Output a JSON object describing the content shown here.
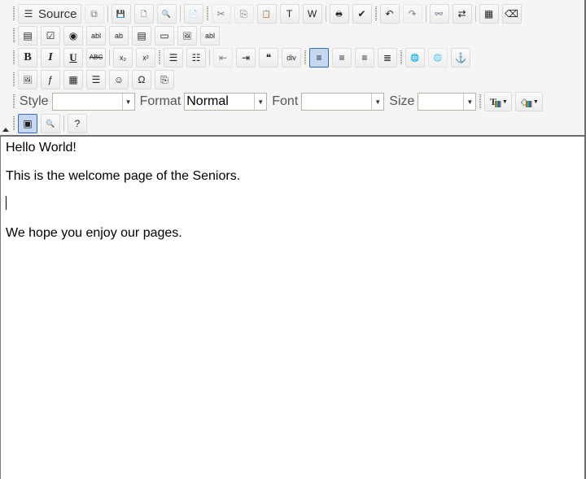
{
  "toolbar": {
    "row1": [
      {
        "name": "source-button",
        "label": "Source",
        "icon": "source-icon",
        "glyph": "☰"
      },
      {
        "name": "templates-button",
        "icon": "templates-icon",
        "glyph": "⧉",
        "disabled": true
      },
      {
        "sep": true
      },
      {
        "name": "save-button",
        "icon": "save-icon",
        "glyph": "💾"
      },
      {
        "name": "new-page-button",
        "icon": "new-page-icon",
        "glyph": "🗋"
      },
      {
        "name": "preview-button",
        "icon": "preview-icon",
        "glyph": "🔍"
      },
      {
        "sep": true
      },
      {
        "name": "document-properties-button",
        "icon": "document-icon",
        "glyph": "📄"
      },
      {
        "grip": true
      },
      {
        "name": "cut-button",
        "icon": "scissors-icon",
        "glyph": "✂",
        "disabled": true
      },
      {
        "name": "copy-button",
        "icon": "copy-icon",
        "glyph": "⎘",
        "disabled": true
      },
      {
        "name": "paste-button",
        "icon": "paste-icon",
        "glyph": "📋"
      },
      {
        "name": "paste-text-button",
        "icon": "paste-text-icon",
        "glyph": "T"
      },
      {
        "name": "paste-word-button",
        "icon": "paste-word-icon",
        "glyph": "W"
      },
      {
        "sep": true
      },
      {
        "name": "print-button",
        "icon": "printer-icon",
        "glyph": "🖶"
      },
      {
        "name": "spellcheck-button",
        "icon": "spellcheck-icon",
        "glyph": "✔"
      },
      {
        "grip": true
      },
      {
        "name": "undo-button",
        "icon": "undo-icon",
        "glyph": "↶"
      },
      {
        "name": "redo-button",
        "icon": "redo-icon",
        "glyph": "↷",
        "disabled": true
      },
      {
        "sep": true
      },
      {
        "name": "find-button",
        "icon": "binoculars-icon",
        "glyph": "👓"
      },
      {
        "name": "replace-button",
        "icon": "replace-icon",
        "glyph": "⇄"
      },
      {
        "sep": true
      },
      {
        "name": "select-all-button",
        "icon": "select-all-icon",
        "glyph": "▦"
      },
      {
        "name": "remove-format-button",
        "icon": "eraser-icon",
        "glyph": "⌫"
      }
    ],
    "row2": [
      {
        "name": "form-button",
        "icon": "form-icon",
        "glyph": "▤"
      },
      {
        "name": "checkbox-button",
        "icon": "checkbox-icon",
        "glyph": "☑"
      },
      {
        "name": "radio-button",
        "icon": "radio-icon",
        "glyph": "◉"
      },
      {
        "name": "text-field-button",
        "icon": "text-field-icon",
        "glyph": "abl"
      },
      {
        "name": "textarea-button",
        "icon": "textarea-icon",
        "glyph": "ab"
      },
      {
        "name": "select-field-button",
        "icon": "select-field-icon",
        "glyph": "▤"
      },
      {
        "name": "form-button-button",
        "icon": "button-icon",
        "glyph": "▭"
      },
      {
        "name": "image-button-button",
        "icon": "image-button-icon",
        "glyph": "🖼"
      },
      {
        "name": "hidden-field-button",
        "icon": "hidden-field-icon",
        "glyph": "abl"
      }
    ],
    "row3": [
      {
        "name": "bold-button",
        "icon": "bold-icon",
        "glyph": "B",
        "style": "b"
      },
      {
        "name": "italic-button",
        "icon": "italic-icon",
        "glyph": "I",
        "style": "i"
      },
      {
        "name": "underline-button",
        "icon": "underline-icon",
        "glyph": "U",
        "style": "u"
      },
      {
        "name": "strikethrough-button",
        "icon": "strikethrough-icon",
        "glyph": "ABC",
        "style": "s"
      },
      {
        "sep": true
      },
      {
        "name": "subscript-button",
        "icon": "subscript-icon",
        "glyph": "x₂"
      },
      {
        "name": "superscript-button",
        "icon": "superscript-icon",
        "glyph": "x²"
      },
      {
        "grip": true
      },
      {
        "name": "numbered-list-button",
        "icon": "numbered-list-icon",
        "glyph": "☰"
      },
      {
        "name": "bulleted-list-button",
        "icon": "bulleted-list-icon",
        "glyph": "☷"
      },
      {
        "sep": true
      },
      {
        "name": "outdent-button",
        "icon": "outdent-icon",
        "glyph": "⇤",
        "disabled": true
      },
      {
        "name": "indent-button",
        "icon": "indent-icon",
        "glyph": "⇥"
      },
      {
        "name": "blockquote-button",
        "icon": "blockquote-icon",
        "glyph": "❝"
      },
      {
        "name": "create-div-button",
        "icon": "div-icon",
        "glyph": "div"
      },
      {
        "grip": true
      },
      {
        "name": "align-left-button",
        "icon": "align-left-icon",
        "glyph": "≡",
        "active": true
      },
      {
        "name": "align-center-button",
        "icon": "align-center-icon",
        "glyph": "≡"
      },
      {
        "name": "align-right-button",
        "icon": "align-right-icon",
        "glyph": "≡"
      },
      {
        "name": "justify-button",
        "icon": "justify-icon",
        "glyph": "≣"
      },
      {
        "grip": true
      },
      {
        "name": "link-button",
        "icon": "link-icon",
        "glyph": "🌐"
      },
      {
        "name": "unlink-button",
        "icon": "unlink-icon",
        "glyph": "🌐",
        "disabled": true
      },
      {
        "name": "anchor-button",
        "icon": "anchor-icon",
        "glyph": "⚓"
      }
    ],
    "row4": [
      {
        "name": "image-button",
        "icon": "image-icon",
        "glyph": "🖼"
      },
      {
        "name": "flash-button",
        "icon": "flash-icon",
        "glyph": "ƒ"
      },
      {
        "name": "table-button",
        "icon": "table-icon",
        "glyph": "▦"
      },
      {
        "name": "horizontal-rule-button",
        "icon": "horizontal-rule-icon",
        "glyph": "☰"
      },
      {
        "name": "smiley-button",
        "icon": "smiley-icon",
        "glyph": "☺"
      },
      {
        "name": "special-char-button",
        "icon": "special-char-icon",
        "glyph": "Ω"
      },
      {
        "name": "page-break-button",
        "icon": "page-break-icon",
        "glyph": "⎘"
      }
    ],
    "row5": {
      "style_label": "Style",
      "style_value": "",
      "format_label": "Format",
      "format_value": "Normal",
      "font_label": "Font",
      "font_value": "",
      "size_label": "Size",
      "size_value": "",
      "text_color_icon": "text-color-icon",
      "bg_color_icon": "background-color-icon"
    },
    "row6": [
      {
        "name": "maximize-button",
        "icon": "maximize-icon",
        "glyph": "▣",
        "active": true
      },
      {
        "name": "show-blocks-button",
        "icon": "show-blocks-icon",
        "glyph": "🔍"
      },
      {
        "sep": true
      },
      {
        "name": "about-button",
        "icon": "help-icon",
        "glyph": "?"
      }
    ]
  },
  "content": {
    "paragraphs": [
      "Hello World!",
      "This is the welcome page of the Seniors.",
      "",
      "We hope you enjoy our pages."
    ]
  }
}
